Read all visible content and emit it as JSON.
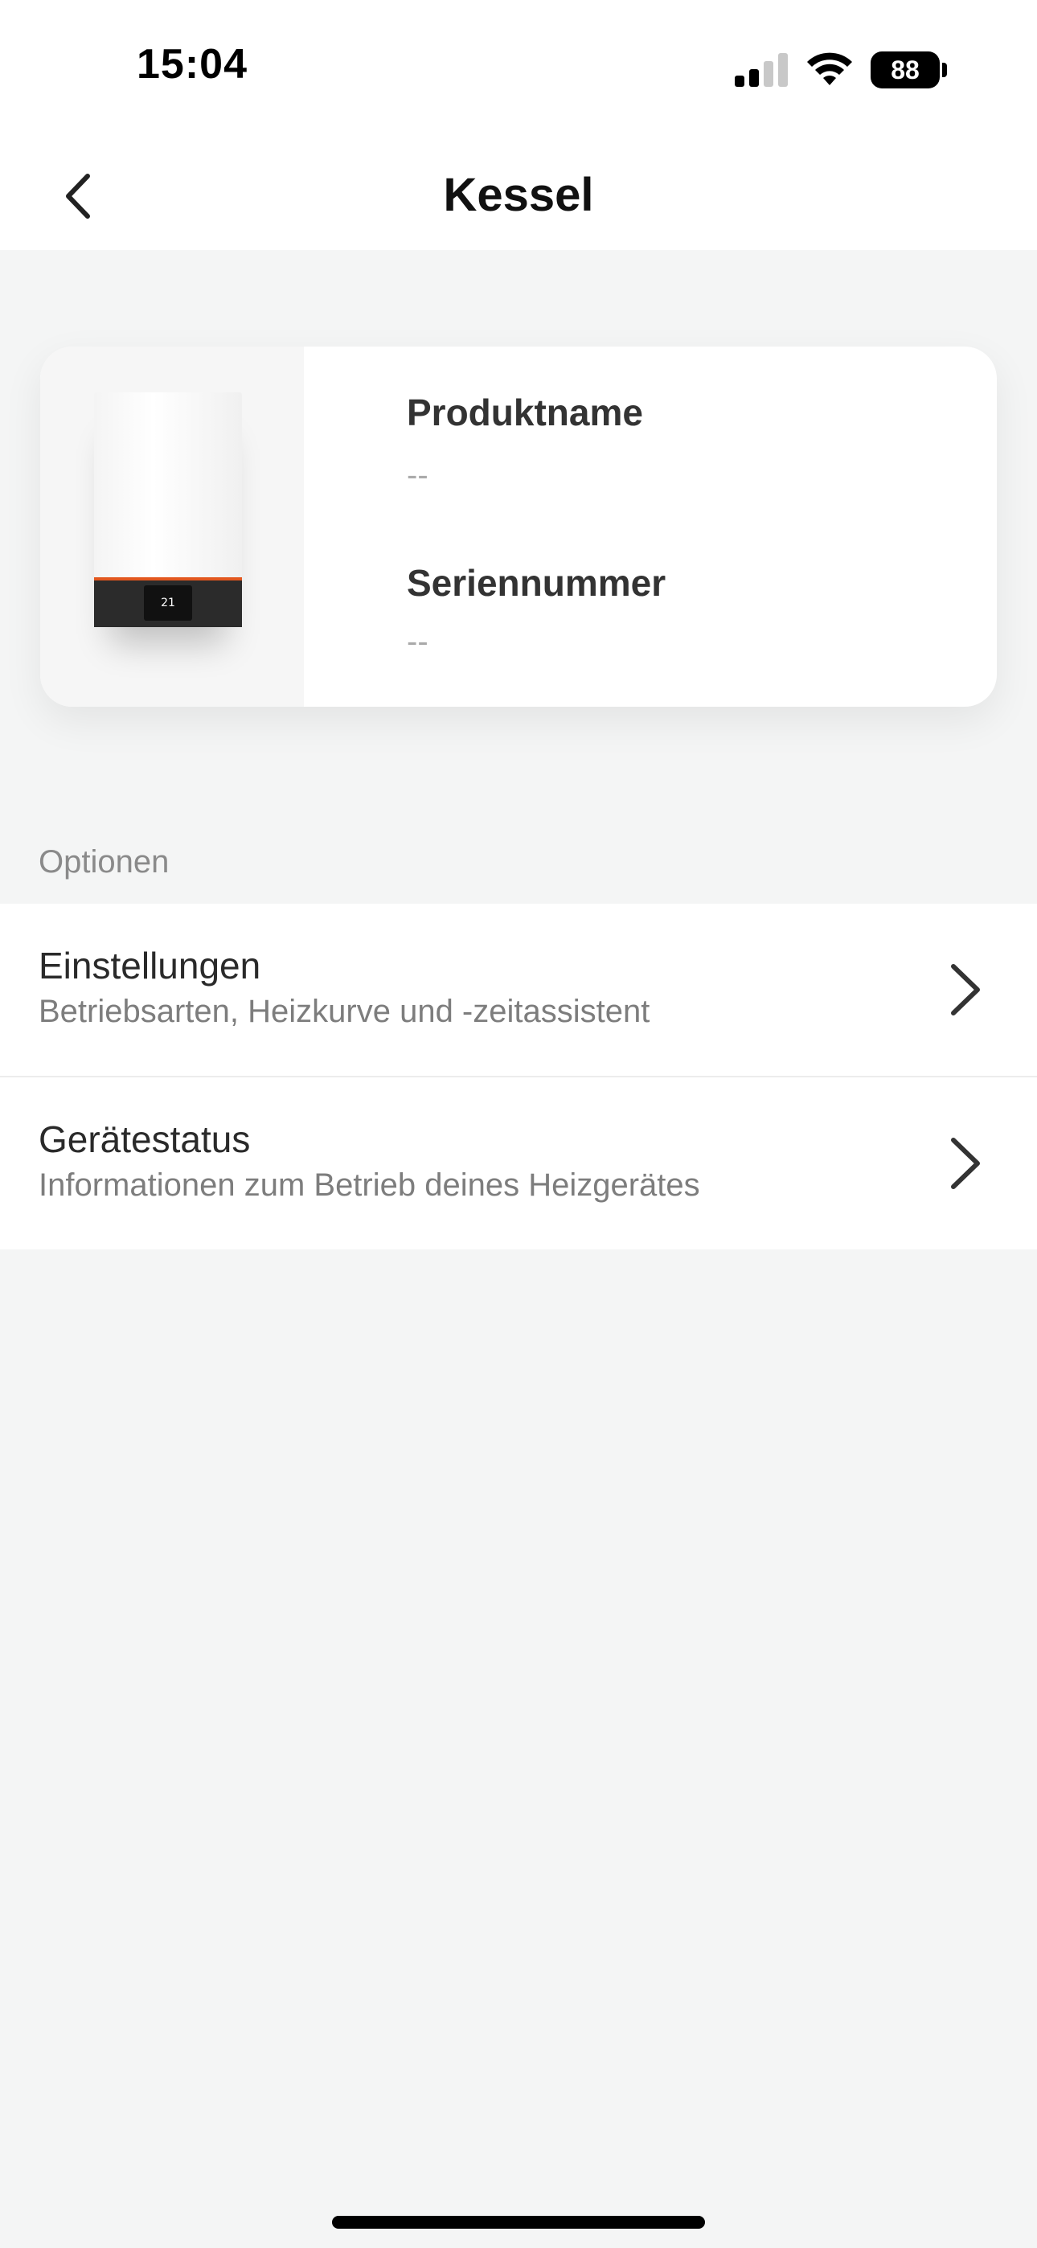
{
  "status_bar": {
    "time": "15:04",
    "battery_level": "88"
  },
  "header": {
    "title": "Kessel",
    "back_icon": "chevron-left-icon"
  },
  "product_card": {
    "image": "boiler-image",
    "boiler_display_value": "21",
    "name_label": "Produktname",
    "name_value": "--",
    "serial_label": "Seriennummer",
    "serial_value": "--"
  },
  "options": {
    "section_title": "Optionen",
    "items": [
      {
        "title": "Einstellungen",
        "subtitle": "Betriebsarten, Heizkurve und -zeitassistent",
        "icon": "chevron-right-icon"
      },
      {
        "title": "Gerätestatus",
        "subtitle": "Informationen zum Betrieb deines Heizgerätes",
        "icon": "chevron-right-icon"
      }
    ]
  },
  "colors": {
    "background": "#f4f5f5",
    "surface": "#ffffff",
    "accent_orange": "#e2571e",
    "text_primary": "#2a2a2a",
    "text_secondary": "#7d7d7d"
  }
}
